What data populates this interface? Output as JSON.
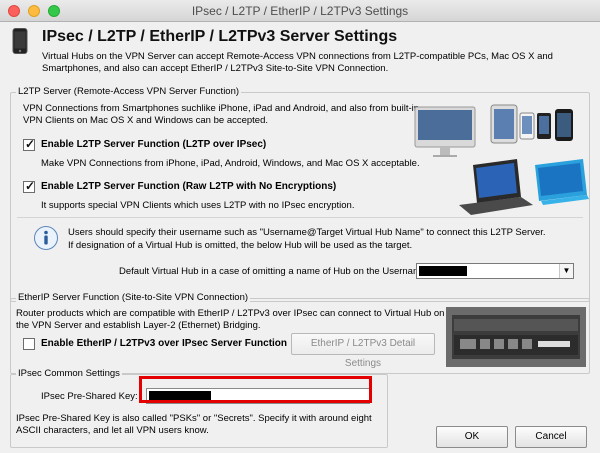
{
  "window": {
    "title": "IPsec / L2TP / EtherIP / L2TPv3 Settings"
  },
  "header": {
    "title": "IPsec / L2TP / EtherIP / L2TPv3 Server Settings",
    "description": "Virtual Hubs on the VPN Server can accept Remote-Access VPN connections from L2TP-compatible PCs, Mac OS X and Smartphones, and also can accept EtherIP / L2TPv3 Site-to-Site VPN Connection."
  },
  "l2tp": {
    "legend": "L2TP Server (Remote-Access VPN Server Function)",
    "intro": "VPN Connections from Smartphones suchlike iPhone, iPad and Android, and also from built-in VPN Clients on Mac OS X and Windows can be accepted.",
    "ipsec_checkbox": {
      "label": "Enable L2TP Server Function (L2TP over IPsec)",
      "checked": true,
      "hint": "Make VPN Connections from iPhone, iPad, Android, Windows, and Mac OS X acceptable."
    },
    "raw_checkbox": {
      "label": "Enable L2TP Server Function (Raw L2TP with No Encryptions)",
      "checked": true,
      "hint": "It supports special VPN Clients which uses L2TP with no IPsec encryption."
    },
    "info_line1": "Users should specify their username such as \"Username@Target Virtual Hub Name\" to connect this L2TP Server.",
    "info_line2": "If designation of a Virtual Hub is omitted, the below Hub will be used as the target.",
    "default_hub_label": "Default Virtual Hub in a case of omitting a name of Hub on the Username:"
  },
  "etherip": {
    "legend": "EtherIP Server Function (Site-to-Site VPN Connection)",
    "intro": "Router products which are compatible with EtherIP / L2TPv3 over IPsec can connect to Virtual Hub on the VPN Server and establish Layer-2 (Ethernet) Bridging.",
    "checkbox": {
      "label": "Enable EtherIP / L2TPv3 over IPsec Server Function",
      "checked": false
    },
    "detail_button": "EtherIP / L2TPv3 Detail Settings"
  },
  "ipsec": {
    "legend": "IPsec Common Settings",
    "psk_label": "IPsec Pre-Shared Key:",
    "note": "IPsec Pre-Shared Key is also called \"PSKs\" or \"Secrets\". Specify it with around eight ASCII characters, and let all VPN users know."
  },
  "buttons": {
    "ok": "OK",
    "cancel": "Cancel"
  },
  "colors": {
    "highlight": "#e40000"
  }
}
